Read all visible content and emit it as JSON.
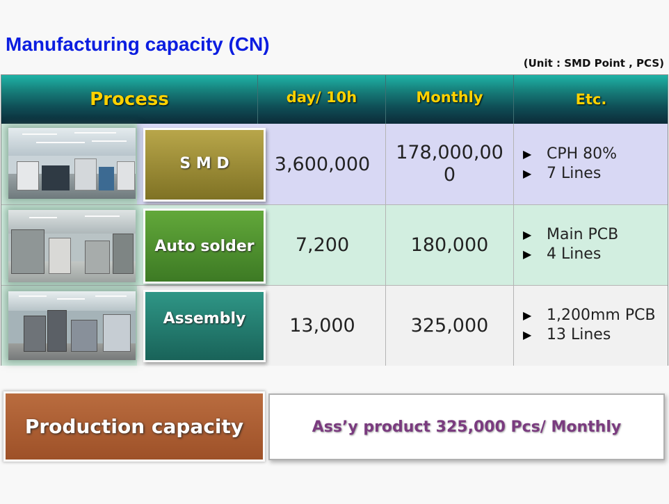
{
  "title": "Manufacturing capacity (CN)",
  "unit_note": "(Unit : SMD Point , PCS)",
  "table": {
    "headers": {
      "process": "Process",
      "day": "day/ 10h",
      "monthly": "Monthly",
      "etc": "Etc."
    },
    "rows": [
      {
        "process": "S M D",
        "day": "3,600,000",
        "monthly": "178,000,000",
        "etc": [
          "CPH 80%",
          "7 Lines"
        ]
      },
      {
        "process": "Auto solder",
        "day": "7,200",
        "monthly": "180,000",
        "etc": [
          "Main PCB",
          "4 Lines"
        ]
      },
      {
        "process": "Assembly",
        "day": "13,000",
        "monthly": "325,000",
        "etc": [
          "1,200mm PCB",
          "13 Lines"
        ]
      }
    ]
  },
  "capacity": {
    "label": "Production capacity",
    "value": "Ass’y product 325,000 Pcs/ Monthly"
  },
  "colors": {
    "title": "#0b1de0",
    "header_text": "#ffd200",
    "row_smd": "#d8d8f4",
    "row_auto": "#d2eee0",
    "row_assembly": "#f1f1f1",
    "btn_smd": "#9a8a2c",
    "btn_auto": "#4b8f2e",
    "btn_assembly": "#237a6d",
    "capacity_box": "#a85a30",
    "capacity_text": "#7a3b7f"
  },
  "icons": {
    "bullet": "triangle-right-icon",
    "photos": [
      "smd-line-photo",
      "auto-solder-line-photo",
      "assembly-line-photo"
    ]
  }
}
